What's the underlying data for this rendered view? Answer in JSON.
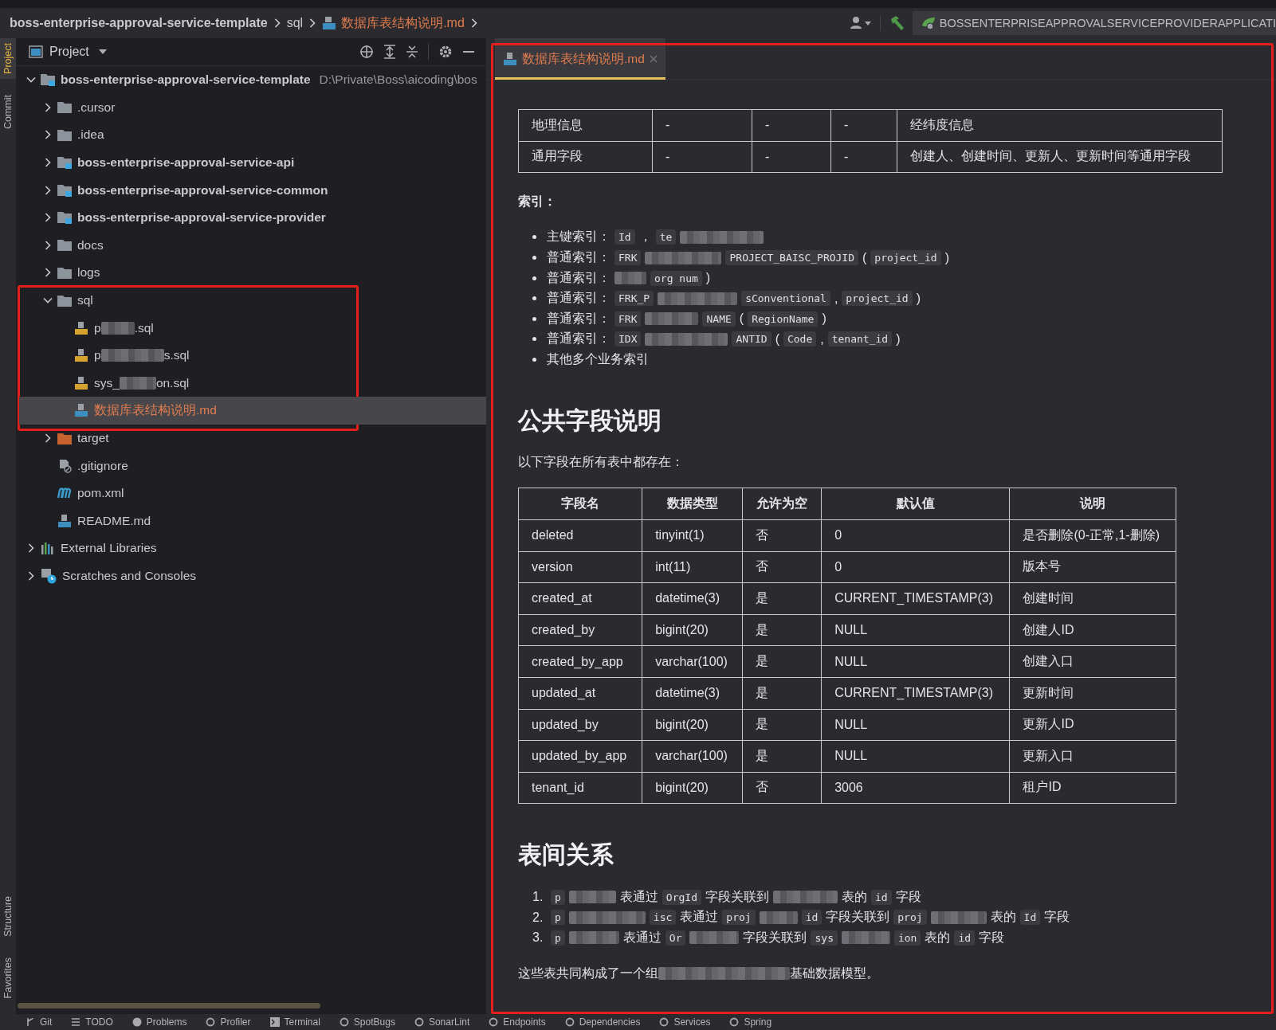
{
  "breadcrumb": [
    {
      "label": "boss-enterprise-approval-service-template",
      "kind": "project",
      "unversioned": false
    },
    {
      "label": "sql",
      "kind": "folder",
      "unversioned": false
    },
    {
      "label": "数据库表结构说明.md",
      "kind": "md",
      "unversioned": true
    }
  ],
  "toolbar": {
    "run_config": "BOSSENTERPRISEAPPROVALSERVICEPROVIDERAPPLICATI"
  },
  "side_tools": {
    "top": [
      {
        "label": "Project",
        "selected": true
      },
      {
        "label": "Commit",
        "selected": false
      }
    ],
    "bottom": [
      {
        "label": "Structure",
        "selected": false
      },
      {
        "label": "Favorites",
        "selected": false
      }
    ]
  },
  "project": {
    "title": "Project",
    "tree": [
      {
        "name": "boss-enterprise-approval-service-template",
        "kind": "module",
        "unversioned": false,
        "path": "D:\\Private\\Boss\\aicoding\\bos",
        "expanded": true,
        "selected": false,
        "children": [
          {
            "name": ".cursor",
            "kind": "folder",
            "unversioned": false,
            "expanded": false,
            "selected": false
          },
          {
            "name": ".idea",
            "kind": "folder",
            "unversioned": false,
            "expanded": false,
            "selected": false
          },
          {
            "name": "boss-enterprise-approval-service-api",
            "kind": "module",
            "unversioned": false,
            "expanded": false,
            "selected": false
          },
          {
            "name": "boss-enterprise-approval-service-common",
            "kind": "module",
            "unversioned": false,
            "expanded": false,
            "selected": false
          },
          {
            "name": "boss-enterprise-approval-service-provider",
            "kind": "module",
            "unversioned": false,
            "expanded": false,
            "selected": false
          },
          {
            "name": "docs",
            "kind": "folder",
            "unversioned": false,
            "expanded": false,
            "selected": false
          },
          {
            "name": "logs",
            "kind": "folder",
            "unversioned": false,
            "expanded": false,
            "selected": false
          },
          {
            "name": "sql",
            "kind": "folder",
            "unversioned": false,
            "expanded": true,
            "selected": false,
            "highlighted": true,
            "children": [
              {
                "name": "p",
                "name_end": ".sql",
                "kind": "sql",
                "unversioned": false,
                "selected": false
              },
              {
                "name": "p",
                "name_end": "s.sql",
                "kind": "sql",
                "unversioned": false,
                "selected": false
              },
              {
                "name": "sys_",
                "name_end": "on.sql",
                "kind": "sql",
                "unversioned": false,
                "selected": false
              },
              {
                "name": "数据库表结构说明.md",
                "kind": "md",
                "unversioned": true,
                "selected": true
              }
            ]
          },
          {
            "name": "target",
            "kind": "excluded",
            "unversioned": false,
            "expanded": false,
            "selected": false
          },
          {
            "name": ".gitignore",
            "kind": "ignore",
            "unversioned": false,
            "selected": false
          },
          {
            "name": "pom.xml",
            "kind": "maven",
            "unversioned": false,
            "selected": false
          },
          {
            "name": "README.md",
            "kind": "md",
            "unversioned": false,
            "selected": false
          }
        ]
      },
      {
        "name": "External Libraries",
        "kind": "libraries",
        "unversioned": false,
        "expanded": false,
        "selected": false
      },
      {
        "name": "Scratches and Consoles",
        "kind": "scratches",
        "unversioned": false,
        "expanded": false,
        "selected": false
      }
    ]
  },
  "editor": {
    "highlighted": true,
    "tabs": [
      {
        "label": "数据库表结构说明.md",
        "kind": "md",
        "unversioned": true,
        "selected": true
      }
    ],
    "doc": [
      {
        "kind": "table",
        "rows": [
          [
            "地理信息",
            "-",
            "-",
            "-",
            "经纬度信息"
          ],
          [
            "通用字段",
            "-",
            "-",
            "-",
            "创建人、创建时间、更新人、更新时间等通用字段"
          ]
        ]
      },
      {
        "kind": "label",
        "text": "索引："
      },
      {
        "kind": "bullets",
        "items": [
          {
            "label": "主键索引：",
            "parts": [
              {
                "kind": "code",
                "text": "Id"
              },
              {
                "kind": "text",
                "text": "，"
              },
              {
                "kind": "code",
                "text": "te"
              },
              {
                "kind": "redacted"
              }
            ]
          },
          {
            "label": "普通索引：",
            "parts": [
              {
                "kind": "code",
                "text": "FRK"
              },
              {
                "kind": "redacted"
              },
              {
                "kind": "code",
                "text": "PROJECT_BAISC_PROJID"
              },
              {
                "kind": "text",
                "text": "("
              },
              {
                "kind": "code",
                "text": "project_id"
              },
              {
                "kind": "text",
                "text": ")"
              }
            ]
          },
          {
            "label": "普通索引：",
            "parts": [
              {
                "kind": "redacted"
              },
              {
                "kind": "code",
                "text": "org num"
              },
              {
                "kind": "text",
                "text": ")"
              }
            ]
          },
          {
            "label": "普通索引：",
            "parts": [
              {
                "kind": "code",
                "text": "FRK_P"
              },
              {
                "kind": "redacted"
              },
              {
                "kind": "code",
                "text": "sConventional"
              },
              {
                "kind": "text",
                "text": ","
              },
              {
                "kind": "code",
                "text": "project_id"
              },
              {
                "kind": "text",
                "text": ")"
              }
            ]
          },
          {
            "label": "普通索引：",
            "parts": [
              {
                "kind": "code",
                "text": "FRK"
              },
              {
                "kind": "redacted"
              },
              {
                "kind": "code",
                "text": "NAME"
              },
              {
                "kind": "text",
                "text": "("
              },
              {
                "kind": "code",
                "text": "RegionName"
              },
              {
                "kind": "text",
                "text": ")"
              }
            ]
          },
          {
            "label": "普通索引：",
            "parts": [
              {
                "kind": "code",
                "text": "IDX"
              },
              {
                "kind": "redacted"
              },
              {
                "kind": "code",
                "text": "ANTID"
              },
              {
                "kind": "text",
                "text": "("
              },
              {
                "kind": "code",
                "text": "Code"
              },
              {
                "kind": "text",
                "text": ","
              },
              {
                "kind": "code",
                "text": "tenant_id"
              },
              {
                "kind": "text",
                "text": ")"
              }
            ]
          },
          {
            "label": "其他多个业务索引"
          }
        ]
      },
      {
        "kind": "heading",
        "text": "公共字段说明"
      },
      {
        "kind": "para",
        "parts": [
          {
            "kind": "text",
            "text": "以下字段在所有表中都存在："
          }
        ]
      },
      {
        "kind": "table",
        "columns": [
          "字段名",
          "数据类型",
          "允许为空",
          "默认值",
          "说明"
        ],
        "rows": [
          [
            "deleted",
            "tinyint(1)",
            "否",
            "0",
            "是否删除(0-正常,1-删除)"
          ],
          [
            "version",
            "int(11)",
            "否",
            "0",
            "版本号"
          ],
          [
            "created_at",
            "datetime(3)",
            "是",
            "CURRENT_TIMESTAMP(3)",
            "创建时间"
          ],
          [
            "created_by",
            "bigint(20)",
            "是",
            "NULL",
            "创建人ID"
          ],
          [
            "created_by_app",
            "varchar(100)",
            "是",
            "NULL",
            "创建入口"
          ],
          [
            "updated_at",
            "datetime(3)",
            "是",
            "CURRENT_TIMESTAMP(3)",
            "更新时间"
          ],
          [
            "updated_by",
            "bigint(20)",
            "是",
            "NULL",
            "更新人ID"
          ],
          [
            "updated_by_app",
            "varchar(100)",
            "是",
            "NULL",
            "更新入口"
          ],
          [
            "tenant_id",
            "bigint(20)",
            "否",
            "3006",
            "租户ID"
          ]
        ]
      },
      {
        "kind": "heading",
        "text": "表间关系"
      },
      {
        "kind": "numbered",
        "items": [
          {
            "number": "1.",
            "parts": [
              {
                "kind": "code",
                "text": "p"
              },
              {
                "kind": "redacted"
              },
              {
                "kind": "text",
                "text": "表通过"
              },
              {
                "kind": "code",
                "text": "OrgId"
              },
              {
                "kind": "text",
                "text": "字段关联到"
              },
              {
                "kind": "redacted"
              },
              {
                "kind": "text",
                "text": "表的"
              },
              {
                "kind": "code",
                "text": "id"
              },
              {
                "kind": "text",
                "text": "字段"
              }
            ]
          },
          {
            "number": "2.",
            "parts": [
              {
                "kind": "code",
                "text": "p"
              },
              {
                "kind": "redacted"
              },
              {
                "kind": "code",
                "text": "isc"
              },
              {
                "kind": "text",
                "text": "表通过"
              },
              {
                "kind": "code",
                "text": "proj"
              },
              {
                "kind": "redacted"
              },
              {
                "kind": "code",
                "text": "id"
              },
              {
                "kind": "text",
                "text": "字段关联到"
              },
              {
                "kind": "code",
                "text": "proj"
              },
              {
                "kind": "redacted"
              },
              {
                "kind": "text",
                "text": "表的"
              },
              {
                "kind": "code",
                "text": "Id"
              },
              {
                "kind": "text",
                "text": "字段"
              }
            ]
          },
          {
            "number": "3.",
            "parts": [
              {
                "kind": "code",
                "text": "p"
              },
              {
                "kind": "redacted"
              },
              {
                "kind": "text",
                "text": "表通过"
              },
              {
                "kind": "code",
                "text": "Or"
              },
              {
                "kind": "redacted"
              },
              {
                "kind": "text",
                "text": "字段关联到"
              },
              {
                "kind": "code",
                "text": "sys"
              },
              {
                "kind": "redacted"
              },
              {
                "kind": "code",
                "text": "ion"
              },
              {
                "kind": "text",
                "text": "表的"
              },
              {
                "kind": "code",
                "text": "id"
              },
              {
                "kind": "text",
                "text": "字段"
              }
            ]
          }
        ]
      },
      {
        "kind": "para",
        "parts": [
          {
            "kind": "text",
            "text": "这些表共同构成了一个组"
          },
          {
            "kind": "redacted"
          },
          {
            "kind": "text",
            "text": "基础数据模型。"
          }
        ]
      }
    ]
  },
  "tool_windows": [
    {
      "label": "Git",
      "kind": "git"
    },
    {
      "label": "TODO",
      "kind": "list"
    },
    {
      "label": "Problems",
      "kind": "problems"
    },
    {
      "label": "Profiler",
      "kind": "profiler"
    },
    {
      "label": "Terminal",
      "kind": "terminal"
    },
    {
      "label": "SpotBugs",
      "kind": "bug"
    },
    {
      "label": "SonarLint",
      "kind": "sonar"
    },
    {
      "label": "Endpoints",
      "kind": "endpoints"
    },
    {
      "label": "Dependencies",
      "kind": "deps"
    },
    {
      "label": "Services",
      "kind": "services"
    },
    {
      "label": "Spring",
      "kind": "spring"
    }
  ]
}
